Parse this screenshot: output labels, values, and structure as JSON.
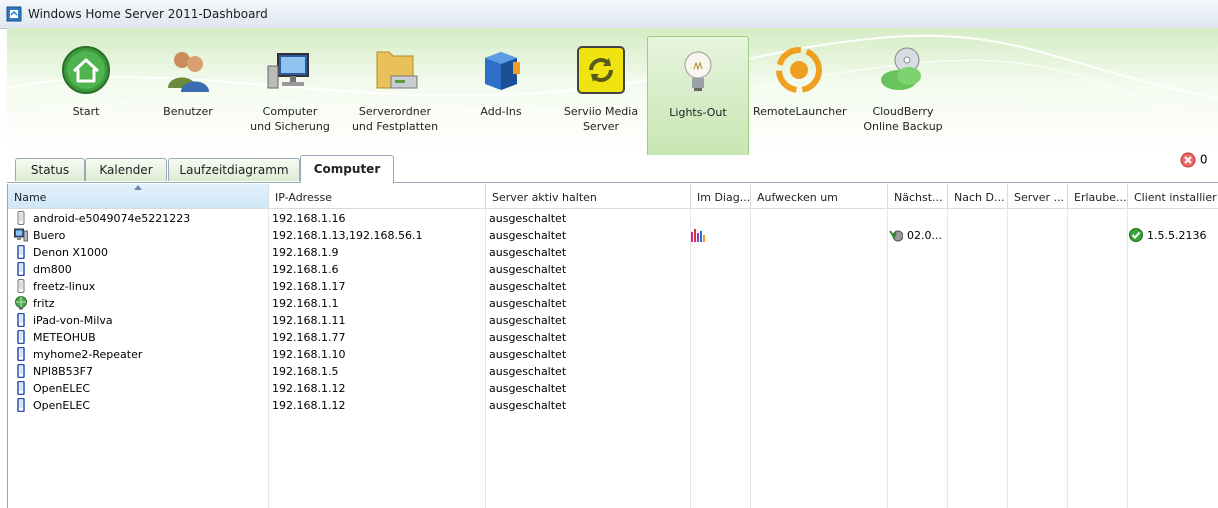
{
  "window": {
    "title": "Windows Home Server 2011-Dashboard"
  },
  "nav": [
    {
      "id": "start",
      "label": "Start",
      "icon": "home-icon"
    },
    {
      "id": "benutzer",
      "label": "Benutzer",
      "icon": "users-icon"
    },
    {
      "id": "computer",
      "label": "Computer\nund Sicherung",
      "icon": "computer-icon"
    },
    {
      "id": "serverordner",
      "label": "Serverordner\nund Festplatten",
      "icon": "folder-drive-icon"
    },
    {
      "id": "addins",
      "label": "Add-Ins",
      "icon": "addins-box-icon"
    },
    {
      "id": "serviio",
      "label": "Serviio Media\nServer",
      "icon": "serviio-icon"
    },
    {
      "id": "lightsout",
      "label": "Lights-Out",
      "icon": "lightbulb-icon"
    },
    {
      "id": "remotelauncher",
      "label": "RemoteLauncher",
      "icon": "remotelauncher-icon"
    },
    {
      "id": "cloudberry",
      "label": "CloudBerry\nOnline Backup",
      "icon": "cloudberry-icon"
    }
  ],
  "tabs": [
    "Status",
    "Kalender",
    "Laufzeitdiagramm",
    "Computer"
  ],
  "active_tab": "Computer",
  "alerts": {
    "critical_count": "0"
  },
  "columns": [
    "Name",
    "IP-Adresse",
    "Server aktiv halten",
    "Im Diag...",
    "Aufwecken um",
    "Nächst...",
    "Nach D...",
    "Server ...",
    "Erlaube...",
    "Client installier"
  ],
  "rows": [
    {
      "name": "android-e5049074e5221223",
      "ip": "192.168.1.16",
      "keep_awake": "ausgeschaltet",
      "icon": "phone-icon"
    },
    {
      "name": "Buero",
      "ip": "192.168.1.13,192.168.56.1",
      "keep_awake": "ausgeschaltet",
      "icon": "monitor-icon",
      "next": "02.0...",
      "client": "1.5.5.2136"
    },
    {
      "name": "Denon X1000",
      "ip": "192.168.1.9",
      "keep_awake": "ausgeschaltet",
      "icon": "device-icon"
    },
    {
      "name": "dm800",
      "ip": "192.168.1.6",
      "keep_awake": "ausgeschaltet",
      "icon": "device-icon"
    },
    {
      "name": "freetz-linux",
      "ip": "192.168.1.17",
      "keep_awake": "ausgeschaltet",
      "icon": "phone-icon"
    },
    {
      "name": "fritz",
      "ip": "192.168.1.1",
      "keep_awake": "ausgeschaltet",
      "icon": "globe-icon"
    },
    {
      "name": "iPad-von-Milva",
      "ip": "192.168.1.11",
      "keep_awake": "ausgeschaltet",
      "icon": "device-icon"
    },
    {
      "name": "METEOHUB",
      "ip": "192.168.1.77",
      "keep_awake": "ausgeschaltet",
      "icon": "device-icon"
    },
    {
      "name": "myhome2-Repeater",
      "ip": "192.168.1.10",
      "keep_awake": "ausgeschaltet",
      "icon": "device-icon"
    },
    {
      "name": "NPI8B53F7",
      "ip": "192.168.1.5",
      "keep_awake": "ausgeschaltet",
      "icon": "device-icon"
    },
    {
      "name": "OpenELEC",
      "ip": "192.168.1.12",
      "keep_awake": "ausgeschaltet",
      "icon": "device-icon"
    },
    {
      "name": "OpenELEC",
      "ip": "192.168.1.12",
      "keep_awake": "ausgeschaltet",
      "icon": "device-icon"
    }
  ],
  "colors": {
    "ribbon_green": "#d4ecc4",
    "header_selected": "#cfe7f7",
    "grid_line": "#d5dbe3"
  }
}
